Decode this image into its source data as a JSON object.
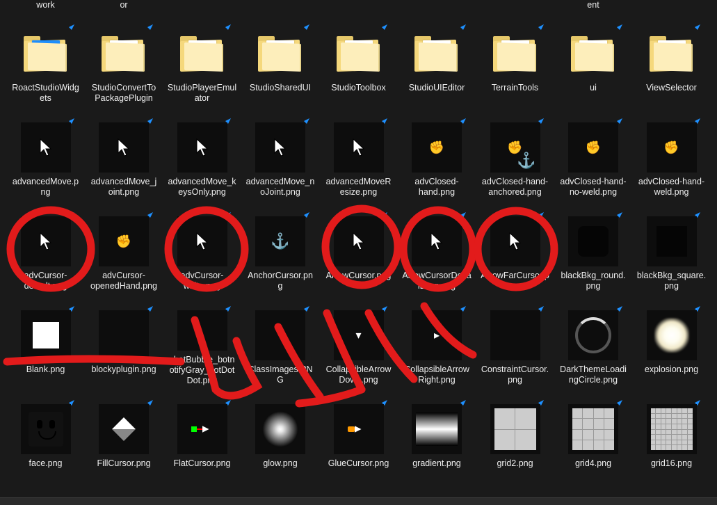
{
  "topRow": [
    {
      "label": "work"
    },
    {
      "label": "or"
    },
    {
      "label": ""
    },
    {
      "label": ""
    },
    {
      "label": ""
    },
    {
      "label": ""
    },
    {
      "label": ""
    },
    {
      "label": "ent"
    },
    {
      "label": ""
    }
  ],
  "rows": [
    [
      {
        "label": "RoactStudioWidgets",
        "kind": "folder",
        "page": "blue"
      },
      {
        "label": "StudioConvertToPackagePlugin",
        "kind": "folder"
      },
      {
        "label": "StudioPlayerEmulator",
        "kind": "folder"
      },
      {
        "label": "StudioSharedUI",
        "kind": "folder"
      },
      {
        "label": "StudioToolbox",
        "kind": "folder"
      },
      {
        "label": "StudioUIEditor",
        "kind": "folder"
      },
      {
        "label": "TerrainTools",
        "kind": "folder"
      },
      {
        "label": "ui",
        "kind": "folder"
      },
      {
        "label": "ViewSelector",
        "kind": "folder"
      }
    ],
    [
      {
        "label": "advancedMove.png",
        "kind": "cursor"
      },
      {
        "label": "advancedMove_joint.png",
        "kind": "cursor"
      },
      {
        "label": "advancedMove_keysOnly.png",
        "kind": "cursor"
      },
      {
        "label": "advancedMove_noJoint.png",
        "kind": "cursor"
      },
      {
        "label": "advancedMoveResize.png",
        "kind": "cursor"
      },
      {
        "label": "advClosed-hand.png",
        "kind": "hand"
      },
      {
        "label": "advClosed-hand-anchored.png",
        "kind": "hand-anchor"
      },
      {
        "label": "advClosed-hand-no-weld.png",
        "kind": "hand"
      },
      {
        "label": "advClosed-hand-weld.png",
        "kind": "hand"
      }
    ],
    [
      {
        "label": "advCursor-default.png",
        "kind": "cursor"
      },
      {
        "label": "advCursor-openedHand.png",
        "kind": "hand"
      },
      {
        "label": "advCursor-white.png",
        "kind": "cursor-white"
      },
      {
        "label": "AnchorCursor.png",
        "kind": "anchor"
      },
      {
        "label": "ArrowCursor.png",
        "kind": "cursor"
      },
      {
        "label": "ArrowCursorDecalDrag.png",
        "kind": "cursor"
      },
      {
        "label": "ArrowFarCursor.png",
        "kind": "cursor-white"
      },
      {
        "label": "blackBkg_round.png",
        "kind": "roundsq"
      },
      {
        "label": "blackBkg_square.png",
        "kind": "blacksq"
      }
    ],
    [
      {
        "label": "Blank.png",
        "kind": "blank"
      },
      {
        "label": "blockyplugin.png",
        "kind": "dark"
      },
      {
        "label": "chatBubble_botnotifyGray_dotDotDot.png",
        "kind": "dark"
      },
      {
        "label": "ClassImages.PNG",
        "kind": "dark"
      },
      {
        "label": "CollapsibleArrowDown.png",
        "kind": "chev-down"
      },
      {
        "label": "CollapsibleArrowRight.png",
        "kind": "chev-right"
      },
      {
        "label": "ConstraintCursor.png",
        "kind": "dark"
      },
      {
        "label": "DarkThemeLoadingCircle.png",
        "kind": "ring"
      },
      {
        "label": "explosion.png",
        "kind": "explosion"
      }
    ],
    [
      {
        "label": "face.png",
        "kind": "face"
      },
      {
        "label": "FillCursor.png",
        "kind": "fill"
      },
      {
        "label": "FlatCursor.png",
        "kind": "flat"
      },
      {
        "label": "glow.png",
        "kind": "glow"
      },
      {
        "label": "GlueCursor.png",
        "kind": "glue"
      },
      {
        "label": "gradient.png",
        "kind": "gradient"
      },
      {
        "label": "grid2.png",
        "kind": "g2"
      },
      {
        "label": "grid4.png",
        "kind": "g4"
      },
      {
        "label": "grid16.png",
        "kind": "g16"
      }
    ]
  ],
  "annotationVisible": true,
  "shortcutBadgeColor": "#1e90ff"
}
